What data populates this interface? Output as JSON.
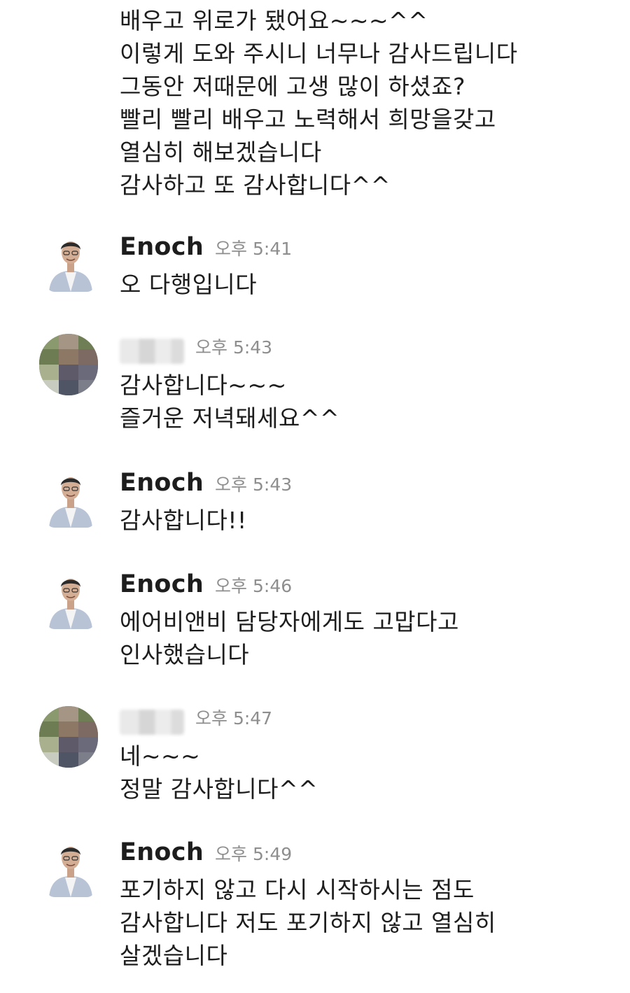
{
  "chat": {
    "top_message": {
      "lines": [
        "배우고 위로가 됐어요~~~^^",
        "이렇게 도와 주시니 너무나 감사드립니다",
        "그동안 저때문에 고생 많이 하셨죠?",
        "빨리 빨리 배우고 노력해서 희망을갖고",
        "열심히 해보겠습니다",
        "감사하고 또 감사합니다^^"
      ]
    },
    "messages": [
      {
        "sender": "Enoch",
        "time": "오후 5:41",
        "lines": [
          "오 다행입니다"
        ]
      },
      {
        "sender": "",
        "time": "오후 5:43",
        "lines": [
          "감사합니다~~~",
          "즐거운 저녁돼세요^^"
        ]
      },
      {
        "sender": "Enoch",
        "time": "오후 5:43",
        "lines": [
          "감사합니다!!"
        ]
      },
      {
        "sender": "Enoch",
        "time": "오후 5:46",
        "lines": [
          "에어비앤비 담당자에게도 고맙다고",
          "인사했습니다"
        ]
      },
      {
        "sender": "",
        "time": "오후 5:47",
        "lines": [
          "네~~~",
          "정말 감사합니다^^"
        ]
      },
      {
        "sender": "Enoch",
        "time": "오후 5:49",
        "lines": [
          "포기하지 않고 다시 시작하시는 점도",
          "감사합니다 저도 포기하지 않고 열심히",
          "살겠습니다"
        ]
      }
    ]
  },
  "colors": {
    "text": "#1d1d1d",
    "timestamp": "#8e8e8e",
    "background": "#ffffff"
  },
  "icons": {
    "enoch_avatar": "person-photo-avatar",
    "other_avatar": "blurred-photo-avatar"
  }
}
